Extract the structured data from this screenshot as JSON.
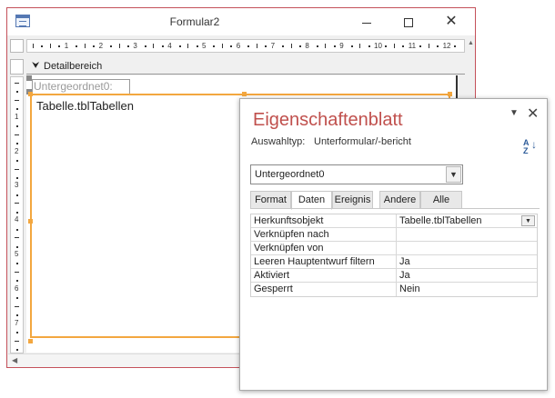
{
  "form_window": {
    "title": "Formular2",
    "minimize_icon": "minimize-icon",
    "maximize_icon": "maximize-icon",
    "close_glyph": "✕"
  },
  "ruler": {
    "h_numbers": [
      "1",
      "2",
      "3",
      "4",
      "5",
      "6",
      "7",
      "8",
      "9",
      "10",
      "11",
      "12"
    ],
    "v_numbers": [
      "1",
      "2",
      "3",
      "4",
      "5",
      "6",
      "7",
      "8"
    ]
  },
  "section": {
    "label": "Detailbereich",
    "icon": "section-arrow-icon"
  },
  "subform": {
    "label": "Untergeordnet0:",
    "content": "Tabelle.tblTabellen"
  },
  "property_sheet": {
    "title": "Eigenschaftenblatt",
    "selection_type_label": "Auswahltyp:",
    "selection_type_value": "Unterformular/-bericht",
    "sort_icon": "sort-az-icon",
    "sort_top": "A",
    "sort_bottom": "Z",
    "object_selector": "Untergeordnet0",
    "tabs": [
      {
        "label": "Format",
        "active": false
      },
      {
        "label": "Daten",
        "active": true
      },
      {
        "label": "Ereignis",
        "active": false
      },
      {
        "label": "Andere",
        "active": false
      },
      {
        "label": "Alle",
        "active": false
      }
    ],
    "properties": [
      {
        "name": "Herkunftsobjekt",
        "value": "Tabelle.tblTabellen"
      },
      {
        "name": "Verknüpfen nach",
        "value": ""
      },
      {
        "name": "Verknüpfen von",
        "value": ""
      },
      {
        "name": "Leeren Hauptentwurf filtern",
        "value": "Ja"
      },
      {
        "name": "Aktiviert",
        "value": "Ja"
      },
      {
        "name": "Gesperrt",
        "value": "Nein"
      }
    ]
  },
  "colors": {
    "title_accent": "#c0504d",
    "selection_frame": "#f3a73f",
    "window_border": "#c4515a"
  }
}
